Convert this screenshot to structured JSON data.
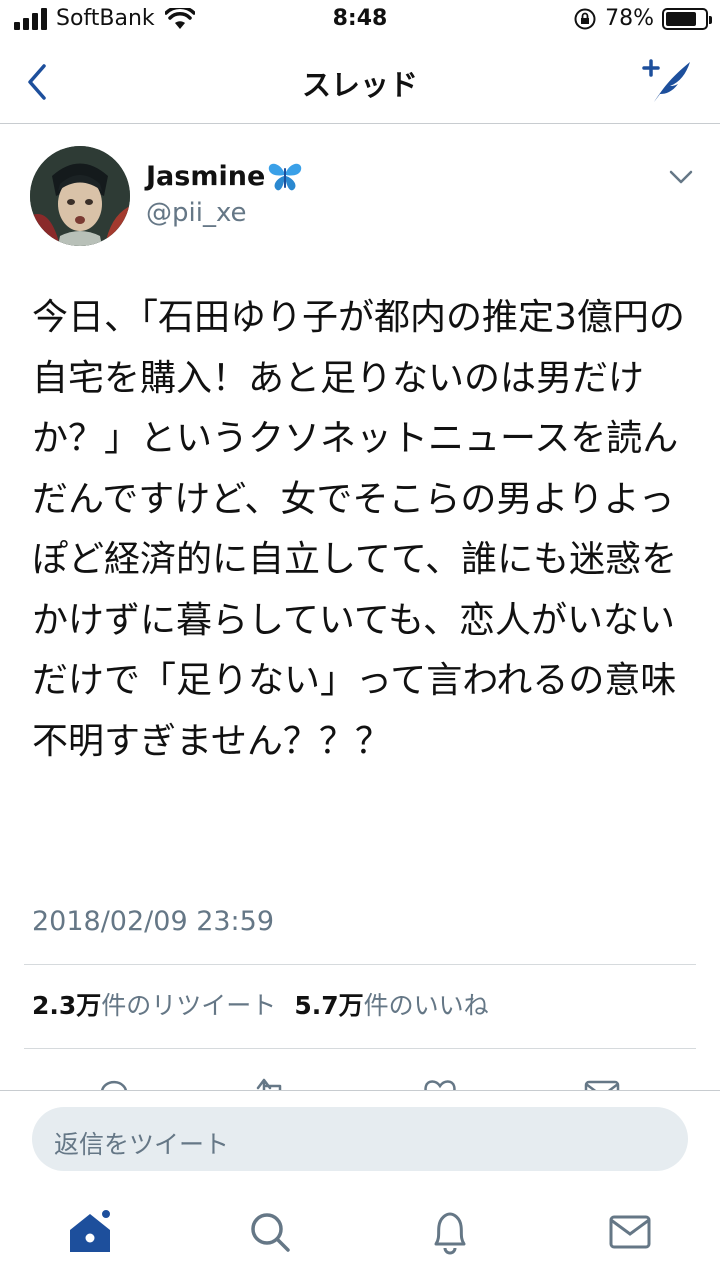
{
  "status_bar": {
    "carrier": "SoftBank",
    "time": "8:48",
    "battery_percent": "78%",
    "battery_level": 0.78
  },
  "nav": {
    "title": "スレッド"
  },
  "tweet": {
    "author_name": "Jasmine",
    "author_handle": "@pii_xe",
    "text": "今日、「石田ゆり子が都内の推定3億円の自宅を購入！あと足りないのは男だけか？」というクソネットニュースを読んだんですけど、女でそこらの男よりよっぽど経済的に自立してて、誰にも迷惑をかけずに暮らしていても、恋人がいないだけで「足りない」って言われるの意味不明すぎません？？？",
    "timestamp": "2018/02/09 23:59",
    "retweets_count": "2.3万",
    "retweets_label": "件のリツイート",
    "likes_count": "5.7万",
    "likes_label": "件のいいね"
  },
  "reply": {
    "placeholder": "返信をツイート"
  },
  "colors": {
    "accent": "#1d4f9c",
    "muted": "#657786",
    "divider": "#d6dadd",
    "reply_bg": "#e6ecf0"
  },
  "icons": [
    "signal-icon",
    "wifi-icon",
    "lock-rotation-icon",
    "battery-icon",
    "back-icon",
    "compose-icon",
    "caret-down-icon",
    "reply-icon",
    "retweet-icon",
    "like-icon",
    "dm-icon",
    "home-icon",
    "search-icon",
    "notifications-icon",
    "messages-icon"
  ]
}
